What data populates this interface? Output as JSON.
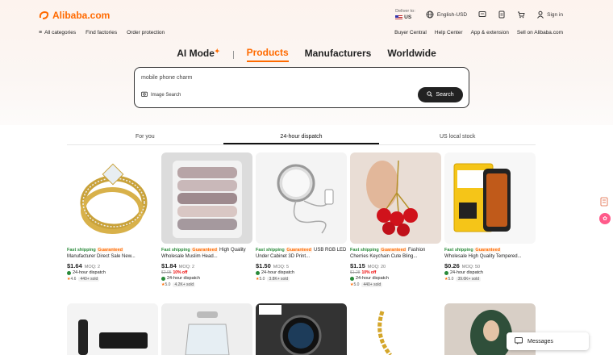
{
  "header": {
    "logo": "Alibaba.com",
    "deliver_to": "Deliver to:",
    "country": "US",
    "language": "English-USD",
    "sign_in": "Sign in"
  },
  "nav_left": [
    "All categories",
    "Find factories",
    "Order protection"
  ],
  "nav_right": [
    "Buyer Central",
    "Help Center",
    "App & extension",
    "Sell on Alibaba.com"
  ],
  "mode_tabs": {
    "ai_mode": "AI Mode",
    "products": "Products",
    "manufacturers": "Manufacturers",
    "worldwide": "Worldwide"
  },
  "search": {
    "query": "mobile phone charm",
    "image_search": "Image Search",
    "button": "Search"
  },
  "sub_tabs": [
    "For you",
    "24-hour dispatch",
    "US local stock"
  ],
  "labels": {
    "fast_shipping": "Fast shipping",
    "guaranteed": "Guaranteed",
    "dispatch": "24-hour dispatch",
    "messages": "Messages"
  },
  "products": [
    {
      "title": "Manufacturer Direct Sale New...",
      "price": "$1.64",
      "moq": "MOQ: 2",
      "old_price": "",
      "discount": "",
      "rating": "4.6",
      "sold": "440+ sold"
    },
    {
      "title": "High Quality Wholesale Muslim Head...",
      "price": "$1.84",
      "moq": "MOQ: 2",
      "old_price": "$2.05",
      "discount": "10% off",
      "rating": "5.0",
      "sold": "4.2K+ sold"
    },
    {
      "title": "USB RGB LED Under Cabinet 3D Print...",
      "price": "$1.50",
      "moq": "MOQ: 5",
      "old_price": "",
      "discount": "",
      "rating": "5.0",
      "sold": "3.8K+ sold"
    },
    {
      "title": "Fashion Cherries Keychain Cute Bling...",
      "price": "$1.15",
      "moq": "MOQ: 20",
      "old_price": "$1.28",
      "discount": "10% off",
      "rating": "5.0",
      "sold": "440+ sold"
    },
    {
      "title": "Wholesale High Quality Tempered...",
      "price": "$0.26",
      "moq": "MOQ: 50",
      "old_price": "",
      "discount": "",
      "rating": "5.0",
      "sold": "39.6K+ sold"
    }
  ],
  "colors": {
    "accent": "#ff6a00",
    "green": "#2a8a3a"
  }
}
